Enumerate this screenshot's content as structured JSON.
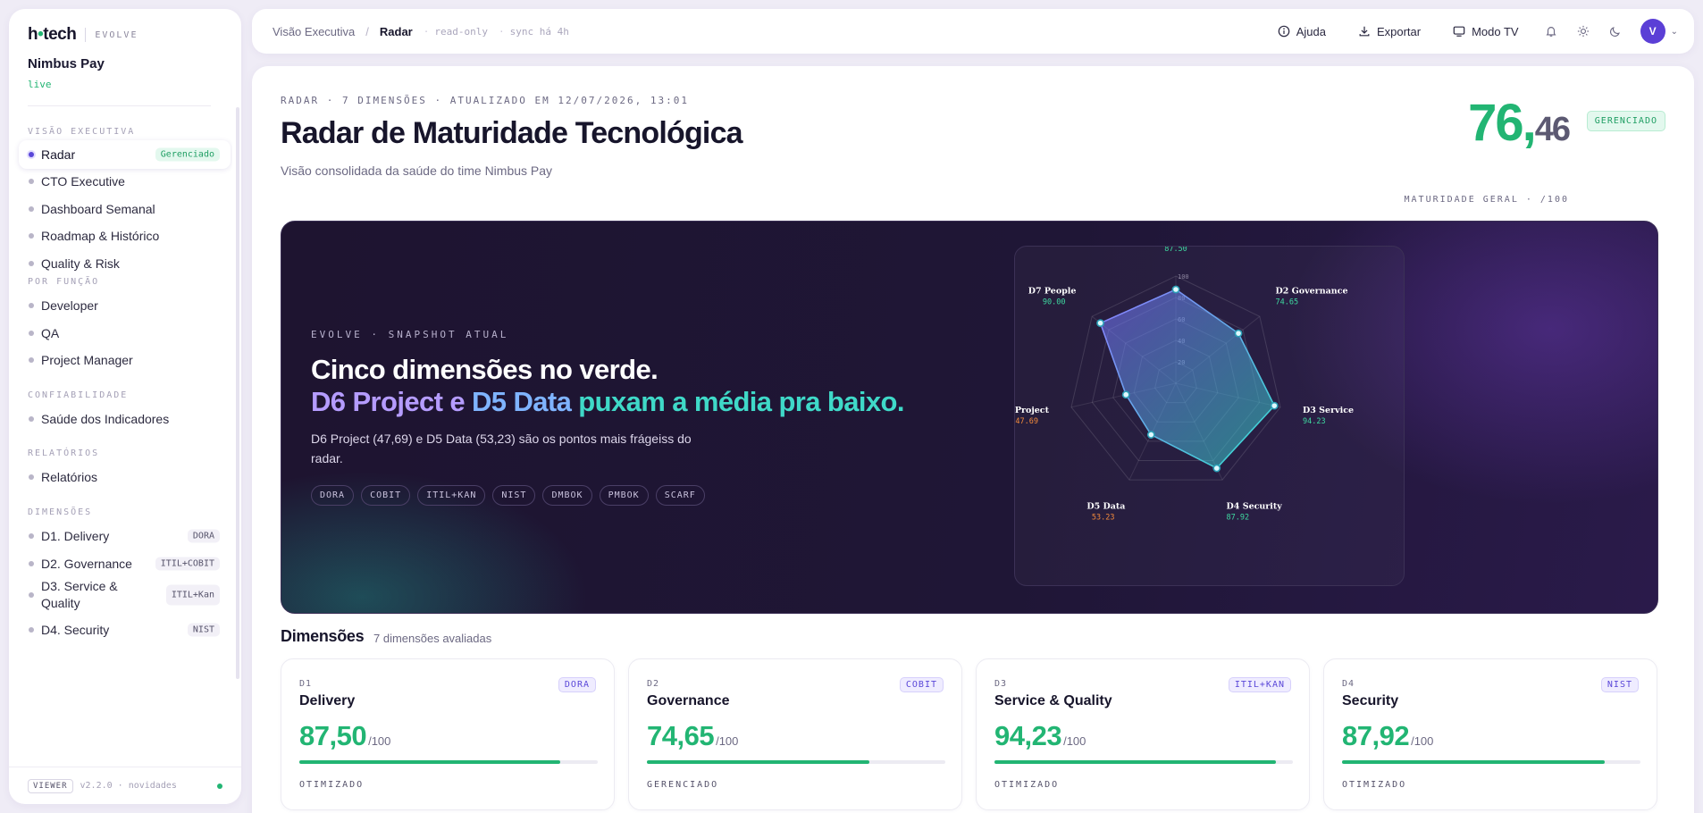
{
  "sidebar": {
    "logo": {
      "pre": "h",
      "dot": "•",
      "post": "tech"
    },
    "brand_tag": "EVOLVE",
    "org_name": "Nimbus Pay",
    "org_status": "live",
    "sections": [
      {
        "label": "VISÃO EXECUTIVA",
        "items": [
          {
            "label": "Radar",
            "tag": "Gerenciado",
            "active": true
          },
          {
            "label": "CTO Executive"
          },
          {
            "label": "Dashboard Semanal"
          },
          {
            "label": "Roadmap & Histórico"
          },
          {
            "label": "Quality & Risk"
          }
        ]
      },
      {
        "label": "POR FUNÇÃO",
        "items": [
          {
            "label": "Developer"
          },
          {
            "label": "QA"
          },
          {
            "label": "Project Manager"
          }
        ]
      },
      {
        "label": "CONFIABILIDADE",
        "items": [
          {
            "label": "Saúde dos Indicadores"
          }
        ]
      },
      {
        "label": "RELATÓRIOS",
        "items": [
          {
            "label": "Relatórios"
          }
        ]
      },
      {
        "label": "DIMENSÕES",
        "items": [
          {
            "label": "D1. Delivery",
            "tag": "DORA"
          },
          {
            "label": "D2. Governance",
            "tag": "ITIL+COBIT"
          },
          {
            "label": "D3. Service & Quality",
            "tag": "ITIL+Kan"
          },
          {
            "label": "D4. Security",
            "tag": "NIST"
          }
        ]
      }
    ],
    "footer": {
      "badge": "VIEWER",
      "version": "v2.2.0 · novidades"
    }
  },
  "topbar": {
    "crumb_1": "Visão Executiva",
    "crumb_sep": "/",
    "crumb_2": "Radar",
    "meta_1": "read-only",
    "meta_2": "sync há 4h",
    "help": "Ajuda",
    "export": "Exportar",
    "tv": "Modo TV",
    "avatar": "V"
  },
  "header": {
    "eyebrow": "RADAR · 7 DIMENSÕES · ATUALIZADO EM 12/07/2026, 13:01",
    "title": "Radar de Maturidade Tecnológica",
    "subtitle": "Visão consolidada da saúde do time Nimbus Pay",
    "score_int": "76,",
    "score_dec": "46",
    "score_badge": "GERENCIADO",
    "score_label": "MATURIDADE GERAL · /100"
  },
  "hero": {
    "eyebrow": "EVOLVE · SNAPSHOT ATUAL",
    "headline_1": "Cinco dimensões no verde.",
    "headline_2_a": "D6 Project e ",
    "headline_2_b": "D5 Data ",
    "headline_2_c": "puxam a média pra baixo.",
    "paragraph": "D6 Project (47,69) e D5 Data (53,23) são os pontos mais frágeiss do radar.",
    "chips": [
      "DORA",
      "COBIT",
      "ITIL+KAN",
      "NIST",
      "DMBOK",
      "PMBOK",
      "SCARF"
    ]
  },
  "chart_data": {
    "type": "radar",
    "rlim": [
      0,
      100
    ],
    "ticks": [
      "20",
      "40",
      "60",
      "80",
      "100"
    ],
    "axes": [
      {
        "label": "D1 Delivery",
        "value": 87.5,
        "display": "87.50",
        "color": "#3fd9a0"
      },
      {
        "label": "D2 Governance",
        "value": 74.65,
        "display": "74.65",
        "color": "#3fd9a0"
      },
      {
        "label": "D3 Service",
        "value": 94.23,
        "display": "94.23",
        "color": "#3fd9a0"
      },
      {
        "label": "D4 Security",
        "value": 87.92,
        "display": "87.92",
        "color": "#3fd9a0"
      },
      {
        "label": "D5 Data",
        "value": 53.23,
        "display": "53.23",
        "color": "#f28a3c"
      },
      {
        "label": "D6 Project",
        "value": 47.69,
        "display": "47.69",
        "color": "#f28a3c"
      },
      {
        "label": "D7 People",
        "value": 90.0,
        "display": "90.00",
        "color": "#3fd9a0"
      }
    ]
  },
  "dimensions": {
    "title": "Dimensões",
    "subtitle": "7 dimensões avaliadas",
    "cards": [
      {
        "code": "D1",
        "name": "Delivery",
        "framework": "DORA",
        "value": "87,50",
        "unit": "/100",
        "progress": 87.5,
        "level": "OTIMIZADO"
      },
      {
        "code": "D2",
        "name": "Governance",
        "framework": "COBIT",
        "value": "74,65",
        "unit": "/100",
        "progress": 74.65,
        "level": "GERENCIADO"
      },
      {
        "code": "D3",
        "name": "Service & Quality",
        "framework": "ITIL+KAN",
        "value": "94,23",
        "unit": "/100",
        "progress": 94.23,
        "level": "OTIMIZADO"
      },
      {
        "code": "D4",
        "name": "Security",
        "framework": "NIST",
        "value": "87,92",
        "unit": "/100",
        "progress": 87.92,
        "level": "OTIMIZADO"
      }
    ]
  },
  "colors": {
    "accent": "#22b573",
    "brand": "#5a47d8",
    "warning": "#f28a3c"
  }
}
